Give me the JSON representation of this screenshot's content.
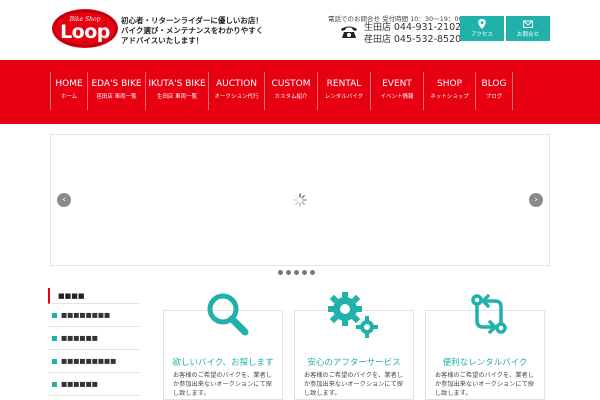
{
  "brand": {
    "logo_sub": "Bike Shop",
    "logo_main": "Loop",
    "tagline": [
      "初心者・リターンライダーに優しいお店！",
      "バイク選び・メンテナンスをわかりやすく",
      "アドバイスいたします！"
    ]
  },
  "contact": {
    "heading": "電話でのお問合せ 受付時間 10：30〜19：00",
    "stores": [
      {
        "name": "生田店",
        "phone": "044-931-2102"
      },
      {
        "name": "荏田店",
        "phone": "045-532-8520"
      }
    ]
  },
  "header_buttons": [
    {
      "label": "アクセス",
      "icon": "map-pin-icon"
    },
    {
      "label": "お問合せ",
      "icon": "mail-icon"
    }
  ],
  "nav": [
    {
      "main": "HOME",
      "sub": "ホーム"
    },
    {
      "main": "EDA'S BIKE",
      "sub": "荏田店 車両一覧"
    },
    {
      "main": "IKUTA'S BIKE",
      "sub": "生田店 車両一覧"
    },
    {
      "main": "AUCTION",
      "sub": "オークション代行"
    },
    {
      "main": "CUSTOM",
      "sub": "カスタム紹介"
    },
    {
      "main": "RENTAL",
      "sub": "レンタルバイク"
    },
    {
      "main": "EVENT",
      "sub": "イベント情報"
    },
    {
      "main": "SHOP",
      "sub": "ネットショップ"
    },
    {
      "main": "BLOG",
      "sub": "ブログ"
    }
  ],
  "slider": {
    "prev": "‹",
    "next": "›",
    "dots": 5
  },
  "sidebar": {
    "title": "■■■■",
    "items": [
      "■■■■■■■■",
      "■■■■■■",
      "■■■■■■■■■",
      "■■■■■■"
    ]
  },
  "cards": [
    {
      "icon": "search-icon",
      "title": "欲しいバイク、お探します",
      "text": "お客様のご希望のバイクを、業者しか参加出来ないオークションにて探し致します。"
    },
    {
      "icon": "gears-icon",
      "title": "安心のアフターサービス",
      "text": "お客様のご希望のバイクを、業者しか参加出来ないオークションにて探し致します。"
    },
    {
      "icon": "swap-icon",
      "title": "便利なレンタルバイク",
      "text": "お客様のご希望のバイクを、業者しか参加出来ないオークションにて探し致します。"
    }
  ],
  "colors": {
    "brand_red": "#e60012",
    "accent_teal": "#20b2aa"
  }
}
